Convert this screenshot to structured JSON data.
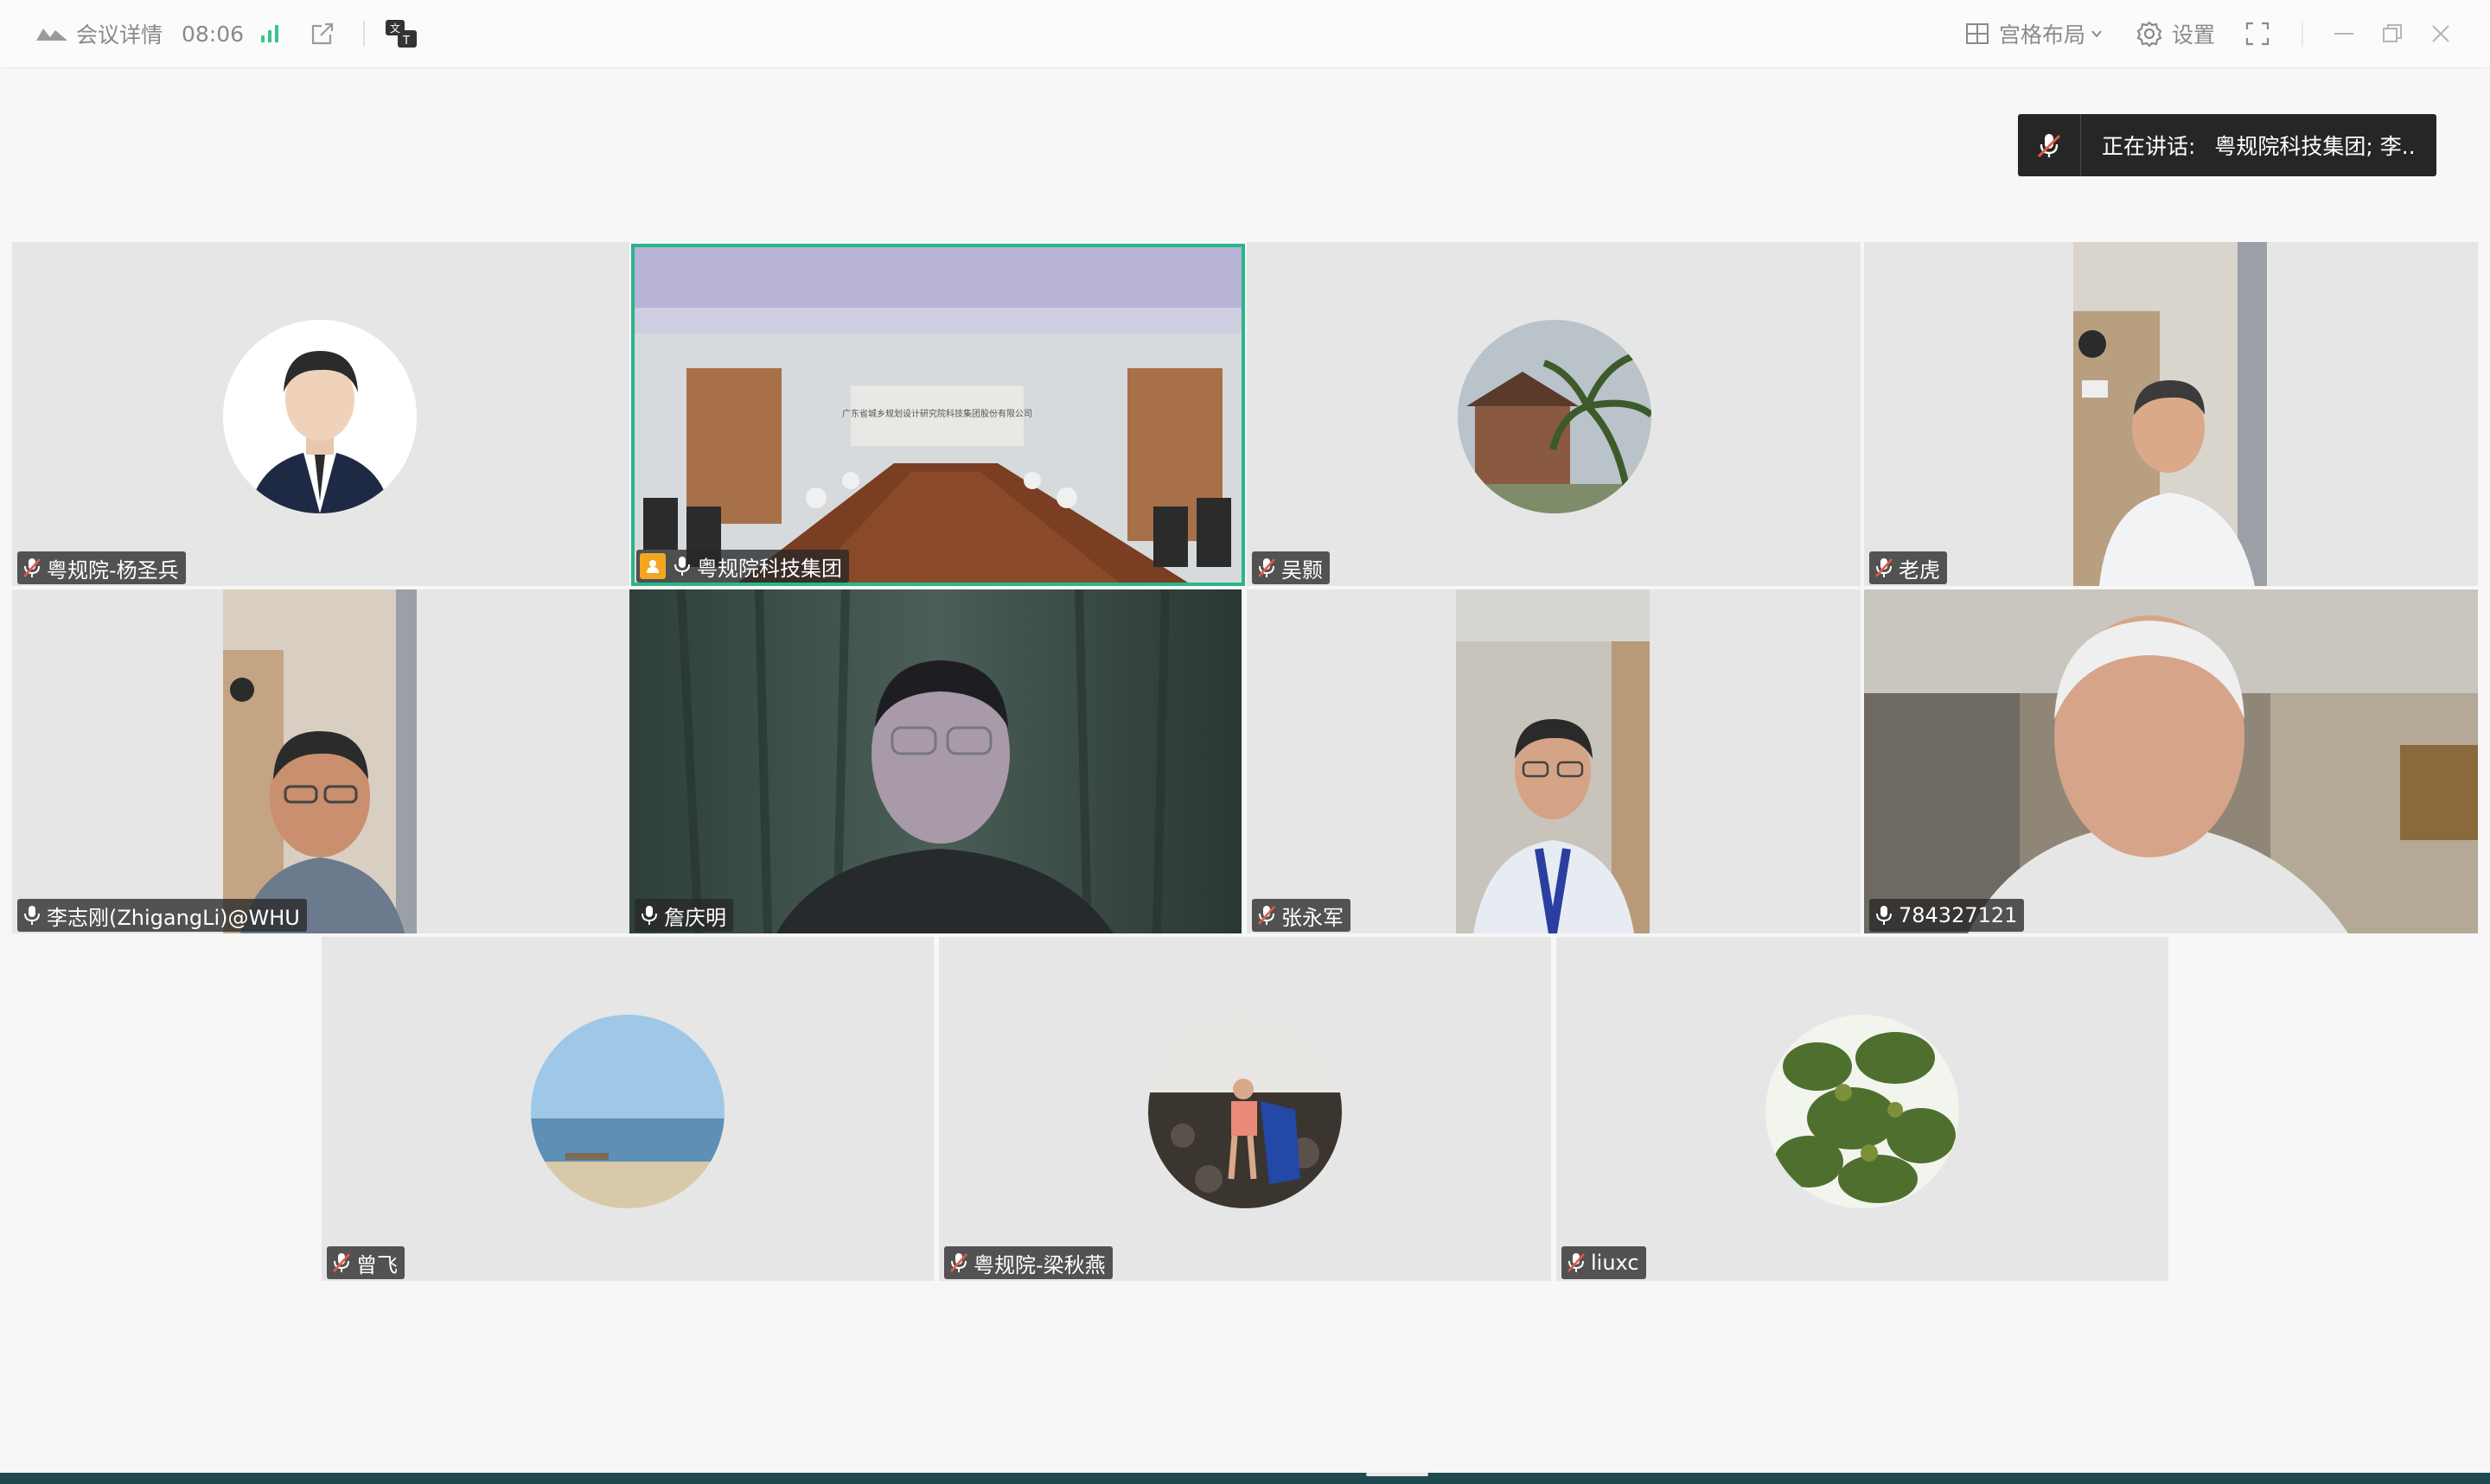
{
  "titlebar": {
    "meeting_details": "会议详情",
    "timer": "08:06",
    "layout_label": "宫格布局",
    "settings_label": "设置"
  },
  "speaking": {
    "prefix": "正在讲话:",
    "name": "粤规院科技集团; 李.."
  },
  "participants": [
    {
      "name": "粤规院-杨圣兵",
      "muted": true,
      "kind": "avatar"
    },
    {
      "name": "粤规院科技集团",
      "muted": false,
      "kind": "video",
      "host": true,
      "active": true
    },
    {
      "name": "吴颢",
      "muted": true,
      "kind": "avatar"
    },
    {
      "name": "老虎",
      "muted": true,
      "kind": "video"
    },
    {
      "name": "李志刚(ZhigangLi)@WHU",
      "muted": false,
      "kind": "video"
    },
    {
      "name": "詹庆明",
      "muted": false,
      "kind": "video"
    },
    {
      "name": "张永军",
      "muted": true,
      "kind": "video"
    },
    {
      "name": "784327121",
      "muted": false,
      "kind": "video"
    },
    {
      "name": "曾飞",
      "muted": true,
      "kind": "avatar"
    },
    {
      "name": "粤规院-梁秋燕",
      "muted": true,
      "kind": "avatar"
    },
    {
      "name": "liuxc",
      "muted": true,
      "kind": "avatar"
    }
  ],
  "room_banner": "广东省城乡规划设计研究院科技集团股份有限公司",
  "colors": {
    "active_border": "#2bb58a",
    "host_badge": "#f4a623",
    "muted_icon": "#e25a4a",
    "signal": "#3cc28b"
  }
}
